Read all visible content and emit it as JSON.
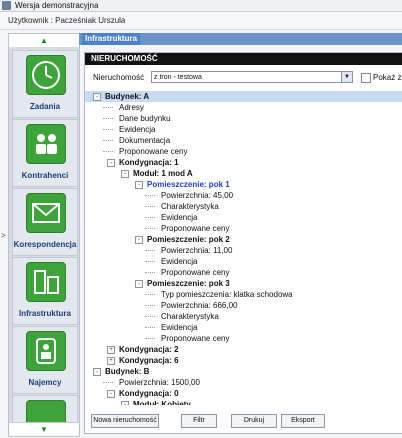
{
  "window": {
    "title": "Wersja demonstracyjna"
  },
  "userbar": {
    "label": "Użytkownik : Pacześniak Urszula"
  },
  "sidebar": {
    "items": [
      {
        "label": "Zadania",
        "icon": "clock-icon"
      },
      {
        "label": "Kontrahenci",
        "icon": "people-icon"
      },
      {
        "label": "Korespondencja",
        "icon": "envelope-icon"
      },
      {
        "label": "Infrastruktura",
        "icon": "buildings-icon"
      },
      {
        "label": "Najemcy",
        "icon": "person-icon"
      }
    ],
    "up_arrow": "▲",
    "down_arrow": "▼",
    "collapse": ">"
  },
  "tabs": {
    "active": "Infrastruktura"
  },
  "panel": {
    "title": "NIERUCHOMOŚĆ",
    "filter_label": "Nieruchomość",
    "filter_value": "z tron - testowa",
    "show_label": "Pokaż zajęte"
  },
  "tree": [
    {
      "text": "Budynek: A",
      "level": 0,
      "bold": true,
      "toggle": "-",
      "highlight": true
    },
    {
      "text": "Adresy",
      "level": 1
    },
    {
      "text": "Dane budynku",
      "level": 1
    },
    {
      "text": "Ewidencja",
      "level": 1
    },
    {
      "text": "Dokumentacja",
      "level": 1
    },
    {
      "text": "Proponowane ceny",
      "level": 1
    },
    {
      "text": "Kondygnacja: 1",
      "level": 1,
      "bold": true,
      "toggle": "-"
    },
    {
      "text": "Moduł: 1 mod A",
      "level": 2,
      "bold": true,
      "toggle": "-"
    },
    {
      "text": "Pomieszczenie: pok 1",
      "level": 3,
      "bold": true,
      "toggle": "-",
      "selected": true
    },
    {
      "text": "Powierzchnia: 45,00",
      "level": 4
    },
    {
      "text": "Charakterystyka",
      "level": 4
    },
    {
      "text": "Ewidencja",
      "level": 4
    },
    {
      "text": "Proponowane ceny",
      "level": 4
    },
    {
      "text": "Pomieszczenie: pok 2",
      "level": 3,
      "bold": true,
      "toggle": "-"
    },
    {
      "text": "Powierzchnia: 11,00",
      "level": 4
    },
    {
      "text": "Ewidencja",
      "level": 4
    },
    {
      "text": "Proponowane ceny",
      "level": 4
    },
    {
      "text": "Pomieszczenie: pok 3",
      "level": 3,
      "bold": true,
      "toggle": "-"
    },
    {
      "text": "Typ pomieszczenia: klatka schodowa",
      "level": 4
    },
    {
      "text": "Powierzchnia: 666,00",
      "level": 4
    },
    {
      "text": "Charakterystyka",
      "level": 4
    },
    {
      "text": "Ewidencja",
      "level": 4
    },
    {
      "text": "Proponowane ceny",
      "level": 4
    },
    {
      "text": "Kondygnacja: 2",
      "level": 1,
      "bold": true,
      "toggle": "+"
    },
    {
      "text": "Kondygnacja: 6",
      "level": 1,
      "bold": true,
      "toggle": "+"
    },
    {
      "text": "Budynek: B",
      "level": 0,
      "bold": true,
      "toggle": "-"
    },
    {
      "text": "Powierzchnia: 1500,00",
      "level": 1
    },
    {
      "text": "Kondygnacja: 0",
      "level": 1,
      "bold": true,
      "toggle": "-"
    },
    {
      "text": "Moduł: Kobiety",
      "level": 2,
      "bold": true,
      "toggle": "-"
    }
  ],
  "buttons": {
    "new": "Nowa nieruchomość",
    "filter": "Filtr",
    "print": "Drukuj",
    "export": "Eksport"
  }
}
